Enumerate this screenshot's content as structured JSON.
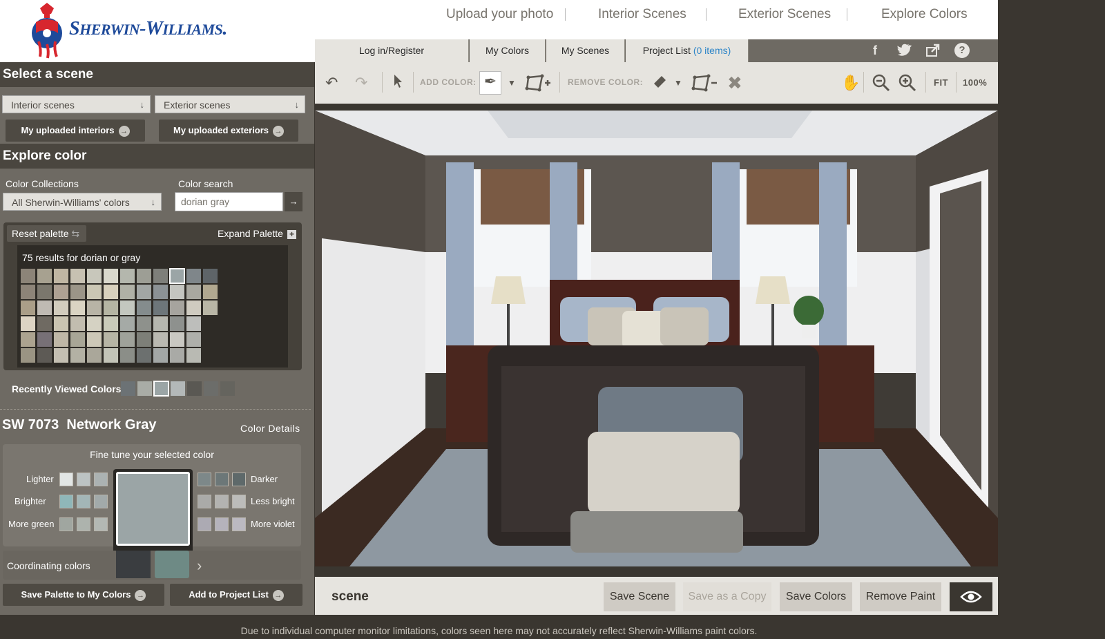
{
  "brand": {
    "name_prefix": "S",
    "name_part1": "HERWIN",
    "name_sep": "-",
    "name_prefix2": "W",
    "name_part2": "ILLIAMS",
    "name_suffix": "."
  },
  "top_nav": [
    "Upload your photo",
    "Interior Scenes",
    "Exterior Scenes",
    "Explore Colors"
  ],
  "tabs": {
    "login": "Log in/Register",
    "my_colors": "My Colors",
    "my_scenes": "My Scenes",
    "project_list": "Project List",
    "project_count": "(0 items)"
  },
  "social_icons": [
    "facebook-icon",
    "twitter-icon",
    "share-icon",
    "help-icon"
  ],
  "left": {
    "select_scene": "Select a scene",
    "interior_select": "Interior scenes",
    "exterior_select": "Exterior scenes",
    "my_uploaded_interiors": "My uploaded interiors",
    "my_uploaded_exteriors": "My uploaded exteriors",
    "explore_color": "Explore color",
    "collections_label": "Color Collections",
    "collections_value": "All Sherwin-Williams' colors",
    "search_label": "Color search",
    "search_value": "dorian gray",
    "reset_palette": "Reset palette",
    "expand_palette": "Expand Palette",
    "results_prefix": "75 results for ",
    "results_term1": "dorian",
    "results_or": " or ",
    "results_term2": "gray",
    "recently_viewed": "Recently Viewed Colors",
    "color_code": "SW 7073",
    "color_name": "Network Gray",
    "color_details": "Color Details",
    "fine_tune": "Fine tune your selected color",
    "lighter": "Lighter",
    "darker": "Darker",
    "brighter": "Brighter",
    "less_bright": "Less bright",
    "more_green": "More green",
    "more_violet": "More violet",
    "coordinating": "Coordinating colors",
    "save_palette": "Save Palette to My Colors",
    "add_project": "Add to Project List"
  },
  "toolbar": {
    "add_color": "ADD COLOR:",
    "remove_color": "REMOVE COLOR:",
    "fit": "FIT",
    "zoom": "100%"
  },
  "bottom": {
    "scene_label": "scene",
    "save_scene": "Save Scene",
    "save_copy": "Save as a Copy",
    "save_colors": "Save Colors",
    "remove_paint": "Remove Paint"
  },
  "disclaimer": "Due to individual computer monitor limitations, colors seen here may not accurately reflect Sherwin-Williams paint colors.",
  "colors": {
    "accent_blue": "#2f86c8",
    "brand_blue": "#1e4a9a",
    "selected_color": "#9ba5a6",
    "palette_grid": [
      [
        "#8c8478",
        "#a7a190",
        "#c0b6a3",
        "#c7c1b2",
        "#c8c7bb",
        "#d9d8cc",
        "#b4b7ad",
        "#9d9e95",
        "#7e7f7a",
        "#9ba5a6",
        "#7f868a",
        "#5e6468"
      ],
      [
        "#8d8478",
        "#7b776d",
        "#aea193",
        "#9b9588",
        "#cbc7b4",
        "#d8d1bd",
        "#b0b1a6",
        "#a2a6a4",
        "#8c9295",
        "#c4c5c0",
        "#a9a8a0",
        "#b1a890"
      ],
      [
        "#aa9e88",
        "#bfbab3",
        "#d2ccbd",
        "#dad4c3",
        "#b8b4a6",
        "#b5b5a3",
        "#c3c7bf",
        "#848c8d",
        "#6d767a",
        "#a6a49e",
        "#cfcbc0",
        "#b9b6a6"
      ],
      [
        "#ddd4c4",
        "#6f6a62",
        "#cac4b1",
        "#c2bdaf",
        "#d5d2c3",
        "#c9cab9",
        "#a5aaa6",
        "#8e918c",
        "#b6b7af",
        "#8e918e",
        "#bdbebb"
      ],
      [
        "#aca38f",
        "#777076",
        "#bfb7a6",
        "#a8a696",
        "#cdc8b7",
        "#b7b5a5",
        "#9fa29a",
        "#7d7f78",
        "#bab9b1",
        "#c9c8c2",
        "#aeafaa"
      ],
      [
        "#9a9483",
        "#5d5a55",
        "#c4bfb2",
        "#b3b1a4",
        "#aaa79a",
        "#c3c4b8",
        "#8b8e88",
        "#6c706f",
        "#a3a7a6",
        "#a9aaa6",
        "#b9bab3"
      ]
    ],
    "recent": [
      "#6c7275",
      "#a9aca6",
      "#9ba5a6",
      "#b3b8b8",
      "#5a5853",
      "#6c6d6a",
      "#65645e"
    ],
    "lighter": [
      "#e2e6e5",
      "#bcc3c3",
      "#abb2b2"
    ],
    "darker": [
      "#7d8889",
      "#6c7778",
      "#5e696a"
    ],
    "brighter": [
      "#8fb7b9",
      "#a3b6b7",
      "#a2aaaa"
    ],
    "less_bright": [
      "#aaaaa8",
      "#b3b3b1",
      "#bcbcba"
    ],
    "more_green": [
      "#a0a6a0",
      "#adb3ad",
      "#b3b8b4"
    ],
    "more_violet": [
      "#acaab3",
      "#b5b3bc",
      "#bbb9c1"
    ],
    "coordinating": [
      "#3a3d40",
      "#6e8a85"
    ]
  }
}
